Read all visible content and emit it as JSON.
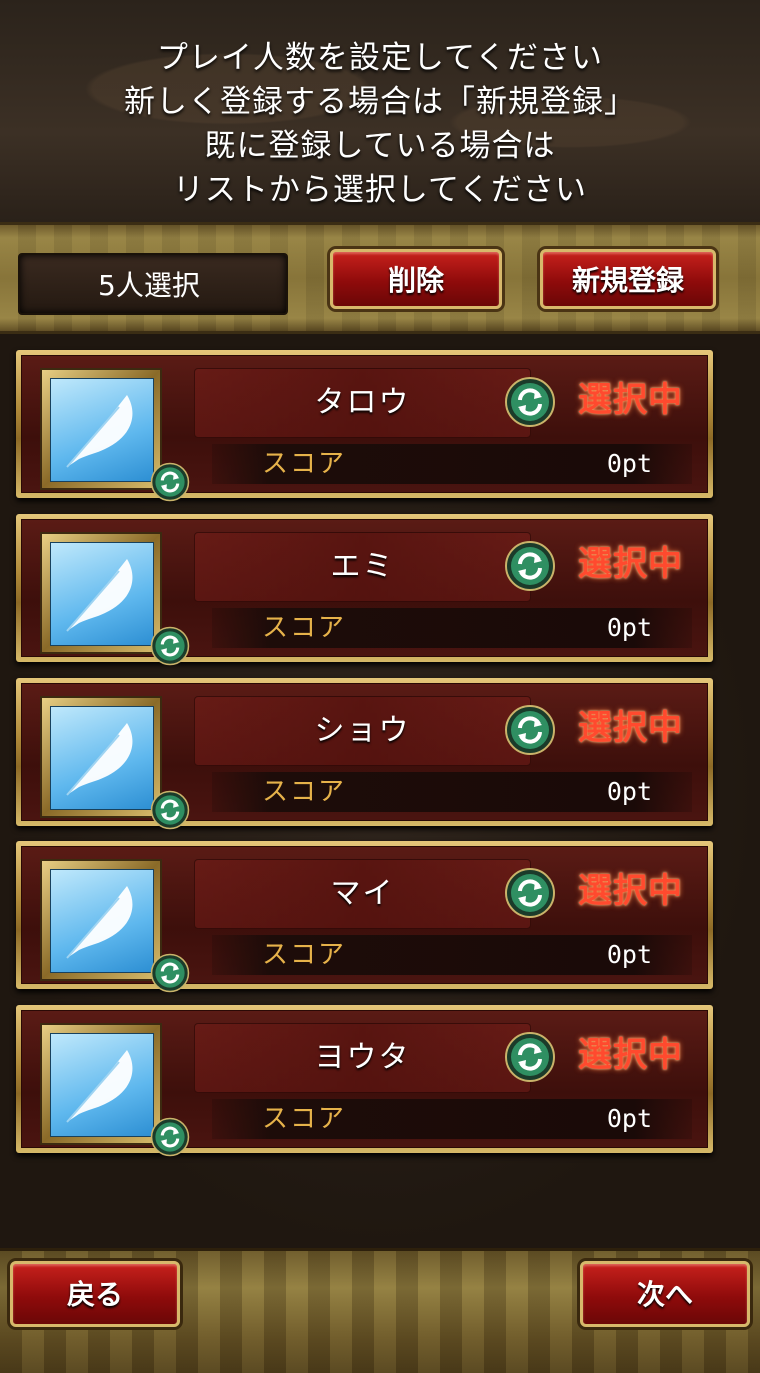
{
  "header": {
    "lines": [
      "プレイ人数を設定してください",
      "新しく登録する場合は「新規登録」",
      "既に登録している場合は",
      "リストから選択してください"
    ]
  },
  "toolbar": {
    "selected_count": "5人選択",
    "delete_label": "削除",
    "new_register_label": "新規登録"
  },
  "players": [
    {
      "name": "タロウ",
      "status": "選択中",
      "score_label": "スコア",
      "score": "0pt"
    },
    {
      "name": "エミ",
      "status": "選択中",
      "score_label": "スコア",
      "score": "0pt"
    },
    {
      "name": "ショウ",
      "status": "選択中",
      "score_label": "スコア",
      "score": "0pt"
    },
    {
      "name": "マイ",
      "status": "選択中",
      "score_label": "スコア",
      "score": "0pt"
    },
    {
      "name": "ヨウタ",
      "status": "選択中",
      "score_label": "スコア",
      "score": "0pt"
    }
  ],
  "footer": {
    "back_label": "戻る",
    "next_label": "次へ"
  },
  "colors": {
    "status": "#ff4a2e",
    "score_label": "#e6b24a",
    "button_red": "#b01410",
    "gold": "#d7b86b"
  },
  "icons": {
    "avatar": "feather-icon",
    "refresh": "refresh-icon"
  }
}
